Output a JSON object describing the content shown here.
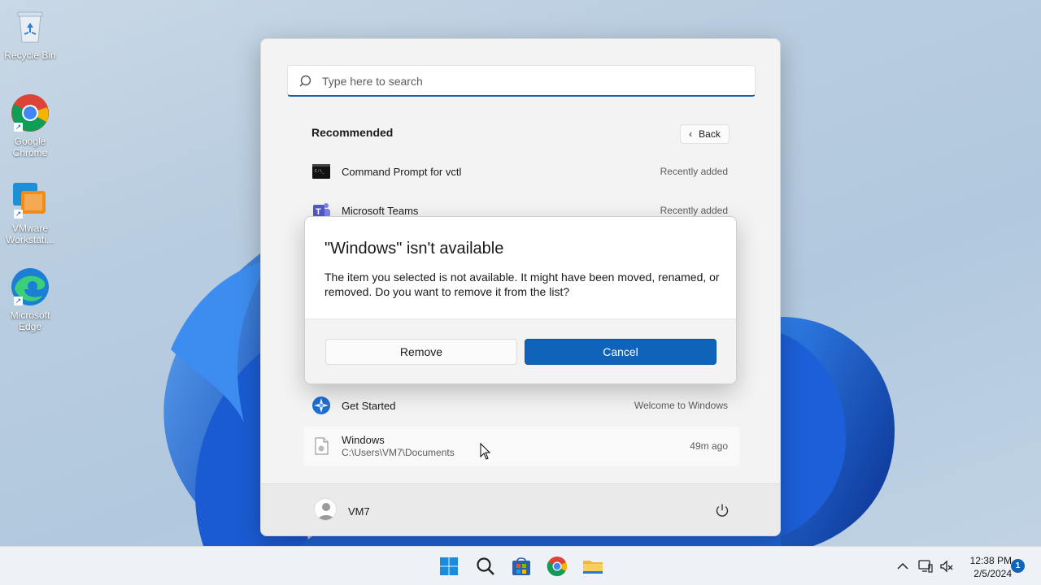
{
  "desktop": {
    "icons": [
      {
        "label": "Recycle Bin",
        "icon": "recycle-bin-icon"
      },
      {
        "label": "Google Chrome",
        "icon": "chrome-icon"
      },
      {
        "label": "VMware Workstati...",
        "icon": "vmware-icon"
      },
      {
        "label": "Microsoft Edge",
        "icon": "edge-icon"
      }
    ]
  },
  "start_menu": {
    "search_placeholder": "Type here to search",
    "recommended_title": "Recommended",
    "back_label": "Back",
    "items": [
      {
        "name": "Command Prompt for vctl",
        "time": "Recently added",
        "icon": "command-prompt-icon"
      },
      {
        "name": "Microsoft Teams",
        "time": "Recently added",
        "icon": "teams-icon"
      },
      {
        "name": "Get Started",
        "time": "Welcome to Windows",
        "icon": "get-started-icon"
      },
      {
        "name": "Windows",
        "path": "C:\\Users\\VM7\\Documents",
        "time": "49m ago",
        "icon": "file-icon"
      }
    ],
    "user_name": "VM7"
  },
  "dialog": {
    "title": "\"Windows\" isn't available",
    "message": "The item you selected is not available. It might have been moved, renamed, or removed. Do you want to remove it from the list?",
    "remove_label": "Remove",
    "cancel_label": "Cancel"
  },
  "taskbar": {
    "apps": [
      "start-icon",
      "search-icon",
      "store-icon",
      "chrome-icon",
      "file-explorer-icon"
    ],
    "time": "12:38 PM",
    "date": "2/5/2024",
    "notification_count": "1"
  },
  "colors": {
    "accent": "#0f63b8",
    "search_underline": "#1c5ea8",
    "wallpaper_bloom": "#1e63d6"
  }
}
